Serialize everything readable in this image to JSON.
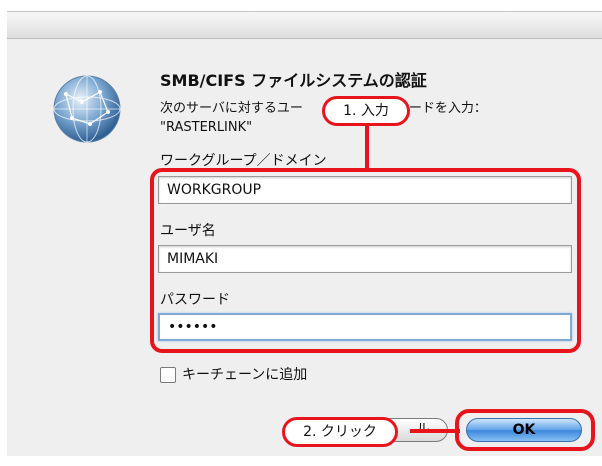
{
  "dialog": {
    "title": "SMB/CIFS ファイルシステムの認証",
    "message_line1_a": "次のサーバに対するユー",
    "message_line1_b": "スワードを入力：",
    "message_line2": "\"RASTERLINK\"",
    "workgroup_label": "ワークグループ／ドメイン",
    "workgroup_value": "WORKGROUP",
    "username_label": "ユーザ名",
    "username_value": "MIMAKI",
    "password_label": "パスワード",
    "password_value": "••••••",
    "keychain_label": "キーチェーンに追加",
    "cancel_label": "ル",
    "ok_label": "OK"
  },
  "annotations": {
    "step1": "1. 入力",
    "step2": "2. クリック"
  },
  "colors": {
    "annotation_red": "#e8141c",
    "ok_blue": "#3b86dc",
    "focus_blue": "#7fa9d8"
  },
  "icons": {
    "server": "network-globe-icon"
  }
}
